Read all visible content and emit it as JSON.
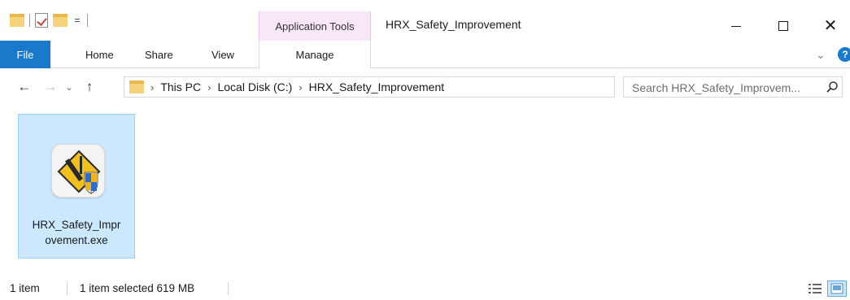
{
  "titlebar": {
    "context_tab": "Application Tools",
    "window_title": "HRX_Safety_Improvement",
    "qat_dropdown": "="
  },
  "ribbon": {
    "tabs": {
      "file": "File",
      "home": "Home",
      "share": "Share",
      "view": "View",
      "manage": "Manage"
    },
    "expand_icon": "chevron-down-icon",
    "help_label": "?"
  },
  "navigation": {
    "back_icon": "arrow-left-icon",
    "forward_icon": "arrow-right-icon",
    "up_icon": "arrow-up-icon",
    "breadcrumbs": [
      "This PC",
      "Local Disk (C:)",
      "HRX_Safety_Improvement"
    ],
    "search_placeholder": "Search HRX_Safety_Improvem..."
  },
  "files": [
    {
      "name_line1": "HRX_Safety_Impr",
      "name_line2": "ovement.exe",
      "selected": true,
      "icon": "installer-shield-icon"
    }
  ],
  "statusbar": {
    "item_count": "1 item",
    "selection": "1 item selected  619 MB"
  },
  "colors": {
    "file_tab": "#1979ca",
    "context_tab_bg": "#f7e7f7",
    "selection_bg": "#cce8ff",
    "selection_border": "#99d1ff",
    "folder": "#f6d27a"
  }
}
